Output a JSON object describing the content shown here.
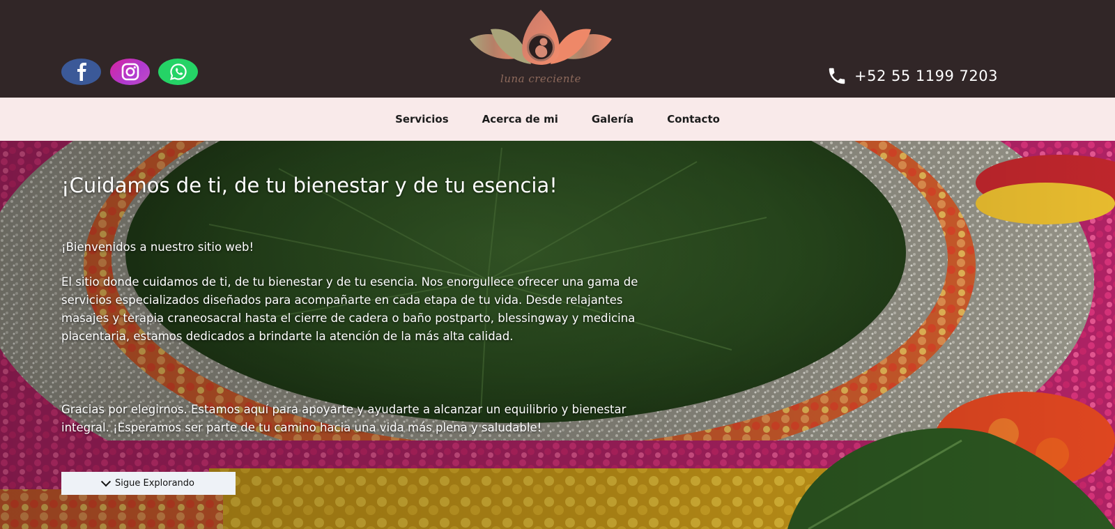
{
  "header": {
    "social": [
      {
        "name": "facebook",
        "icon": "facebook-icon",
        "color": "#3b5998"
      },
      {
        "name": "instagram",
        "icon": "instagram-icon",
        "color": "#c13584"
      },
      {
        "name": "whatsapp",
        "icon": "whatsapp-icon",
        "color": "#25d366"
      }
    ],
    "logo_text": "luna creciente",
    "phone": "+52 55 1199 7203",
    "background": "#312627"
  },
  "nav": {
    "items": [
      {
        "label": "Servicios"
      },
      {
        "label": "Acerca de mi"
      },
      {
        "label": "Galería"
      },
      {
        "label": "Contacto"
      }
    ],
    "background": "#f9eaea"
  },
  "hero": {
    "title": "¡Cuidamos de ti, de tu bienestar y de tu esencia!",
    "welcome": "¡Bienvenidos a nuestro sitio web!",
    "paragraph1": "El sitio donde cuidamos de ti, de tu bienestar y de tu esencia. Nos enorgullece ofrecer una gama de servicios especializados diseñados para acompañarte en cada etapa de tu vida. Desde relajantes masajes y terapia craneosacral hasta el cierre de cadera o baño postparto, blessingway y medicina placentaria, estamos dedicados a brindarte la atención de la más alta calidad.",
    "paragraph2": "Gracias por elegirnos. Estamos aquí para apoyarte y ayudarte a alcanzar un equilibrio y bienestar integral. ¡Esperamos ser parte de tu camino hacia una vida más plena y saludable!",
    "button_label": "Sigue Explorando"
  }
}
